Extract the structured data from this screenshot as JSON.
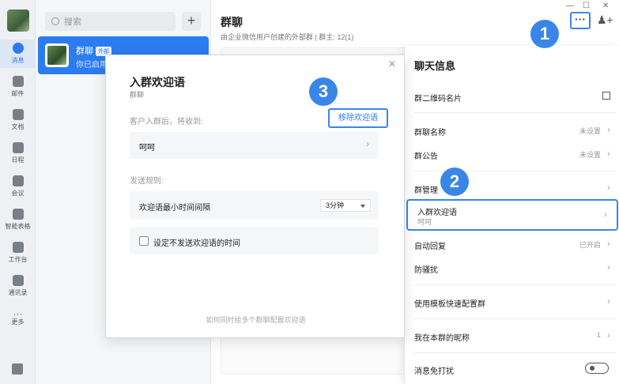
{
  "rail": {
    "items": [
      {
        "label": "消息"
      },
      {
        "label": "邮件"
      },
      {
        "label": "文档"
      },
      {
        "label": "日程"
      },
      {
        "label": "会议"
      },
      {
        "label": "智能表格"
      },
      {
        "label": "工作台"
      },
      {
        "label": "通讯录"
      },
      {
        "label": "更多"
      }
    ]
  },
  "list": {
    "search_placeholder": "搜索",
    "add_label": "+",
    "conversation": {
      "name": "群聊",
      "tag": "外部",
      "preview": "你已启用"
    }
  },
  "main": {
    "title": "群聊",
    "subtitle": "由企业微信用户创建的外部群 | 群主: 12(1)",
    "more_label": "···"
  },
  "drawer": {
    "title": "聊天信息",
    "rows": [
      {
        "label": "群二维码名片"
      },
      {
        "label": "群聊名称",
        "value": "未设置"
      },
      {
        "label": "群公告",
        "value": "未设置"
      },
      {
        "label": "群管理"
      },
      {
        "label": "入群欢迎语",
        "sub": "呵呵"
      },
      {
        "label": "自动回复",
        "value": "已开启"
      },
      {
        "label": "防骚扰"
      },
      {
        "label": "使用模板快速配置群"
      },
      {
        "label": "我在本群的昵称",
        "value": "1"
      },
      {
        "label": "消息免打扰"
      }
    ]
  },
  "modal": {
    "title": "入群欢迎语",
    "subtitle": "群聊",
    "receive_label": "客户入群后，将收到:",
    "remove_label": "移除欢迎语",
    "welcome_text": "呵呵",
    "rules_label": "发送规则:",
    "interval_label": "欢迎语最小时间间隔",
    "interval_value": "3分钟",
    "checkbox_label": "设定不发送欢迎语的时间",
    "hint": "如何同时给多个群聊配置欢迎语"
  },
  "badges": [
    "1",
    "2",
    "3"
  ],
  "colors": {
    "accent": "#2b7cf0",
    "highlight": "#3a86e8"
  }
}
